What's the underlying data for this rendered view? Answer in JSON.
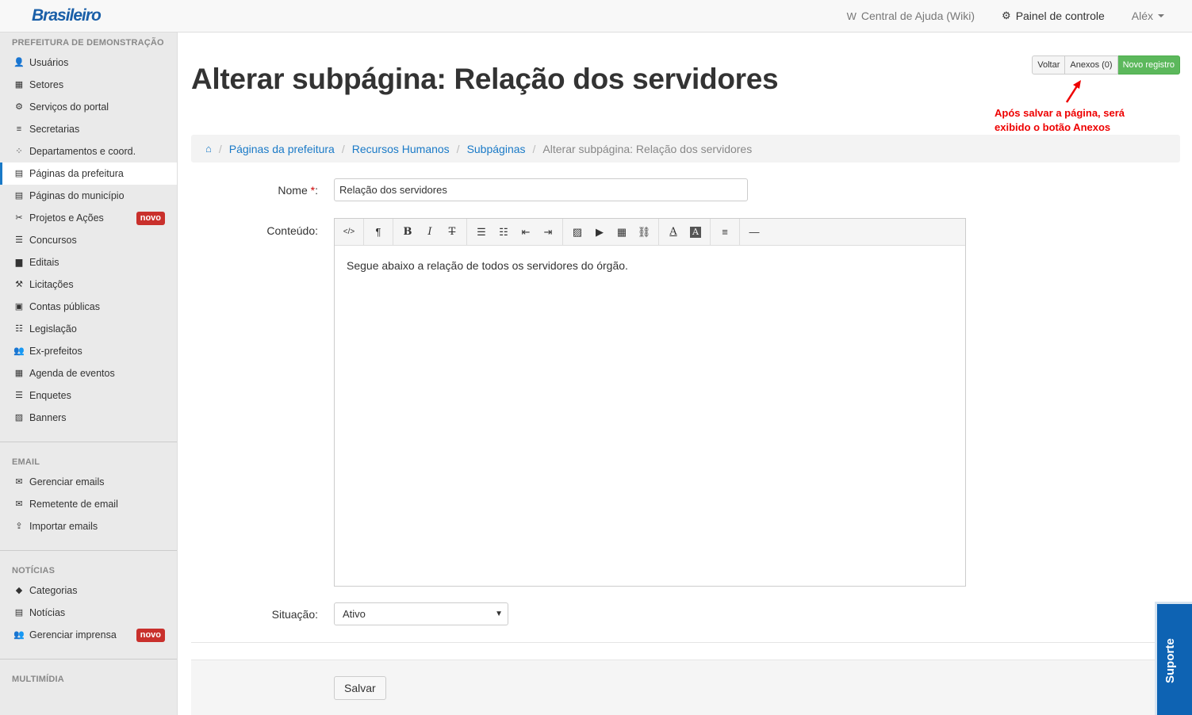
{
  "app": {
    "logo": "Brasileiro"
  },
  "topnav": {
    "help_icon": "W",
    "help": "Central de Ajuda (Wiki)",
    "panel": "Painel de controle",
    "user": "Aléx"
  },
  "sidebar": {
    "sections": [
      {
        "title": "PREFEITURA DE DEMONSTRAÇÃO"
      },
      {
        "title": "EMAIL"
      },
      {
        "title": "NOTÍCIAS"
      },
      {
        "title": "MULTIMÍDIA"
      }
    ],
    "prefeitura": [
      {
        "label": "Usuários",
        "icon": "👤"
      },
      {
        "label": "Setores",
        "icon": "▦"
      },
      {
        "label": "Serviços do portal",
        "icon": "⚙"
      },
      {
        "label": "Secretarias",
        "icon": "≡"
      },
      {
        "label": "Departamentos e coord.",
        "icon": "⁘"
      },
      {
        "label": "Páginas da prefeitura",
        "icon": "▤"
      },
      {
        "label": "Páginas do município",
        "icon": "▤"
      },
      {
        "label": "Projetos e Ações",
        "icon": "✂",
        "badge": "novo"
      },
      {
        "label": "Concursos",
        "icon": "☰"
      },
      {
        "label": "Editais",
        "icon": "▆"
      },
      {
        "label": "Licitações",
        "icon": "⚒"
      },
      {
        "label": "Contas públicas",
        "icon": "▣"
      },
      {
        "label": "Legislação",
        "icon": "☷"
      },
      {
        "label": "Ex-prefeitos",
        "icon": "👥"
      },
      {
        "label": "Agenda de eventos",
        "icon": "▦"
      },
      {
        "label": "Enquetes",
        "icon": "☰"
      },
      {
        "label": "Banners",
        "icon": "▨"
      }
    ],
    "email": [
      {
        "label": "Gerenciar emails",
        "icon": "✉"
      },
      {
        "label": "Remetente de email",
        "icon": "✉"
      },
      {
        "label": "Importar emails",
        "icon": "⇪"
      }
    ],
    "noticias": [
      {
        "label": "Categorias",
        "icon": "◆"
      },
      {
        "label": "Notícias",
        "icon": "▤"
      },
      {
        "label": "Gerenciar imprensa",
        "icon": "👥",
        "badge": "novo"
      }
    ]
  },
  "page": {
    "title": "Alterar subpágina: Relação dos servidores",
    "buttons": {
      "back": "Voltar",
      "attachments": "Anexos (0)",
      "new": "Novo registro"
    },
    "annotation": "Após salvar a página, será exibido o botão Anexos"
  },
  "breadcrumb": {
    "items": [
      "Páginas da prefeitura",
      "Recursos Humanos",
      "Subpáginas"
    ],
    "current": "Alterar subpágina: Relação dos servidores"
  },
  "form": {
    "name_label": "Nome",
    "name_required": "*",
    "name_colon": ":",
    "name_value": "Relação dos servidores",
    "content_label": "Conteúdo:",
    "content_value": "Segue abaixo a relação de todos os servidores do órgão.",
    "status_label": "Situação:",
    "status_value": "Ativo",
    "save": "Salvar"
  },
  "toolbar": {
    "code": "</>",
    "paragraph": "¶",
    "bold": "B",
    "italic": "I",
    "strike": "T",
    "text_color": "A",
    "text_bg": "A",
    "hr": "—"
  },
  "support": "Suporte"
}
